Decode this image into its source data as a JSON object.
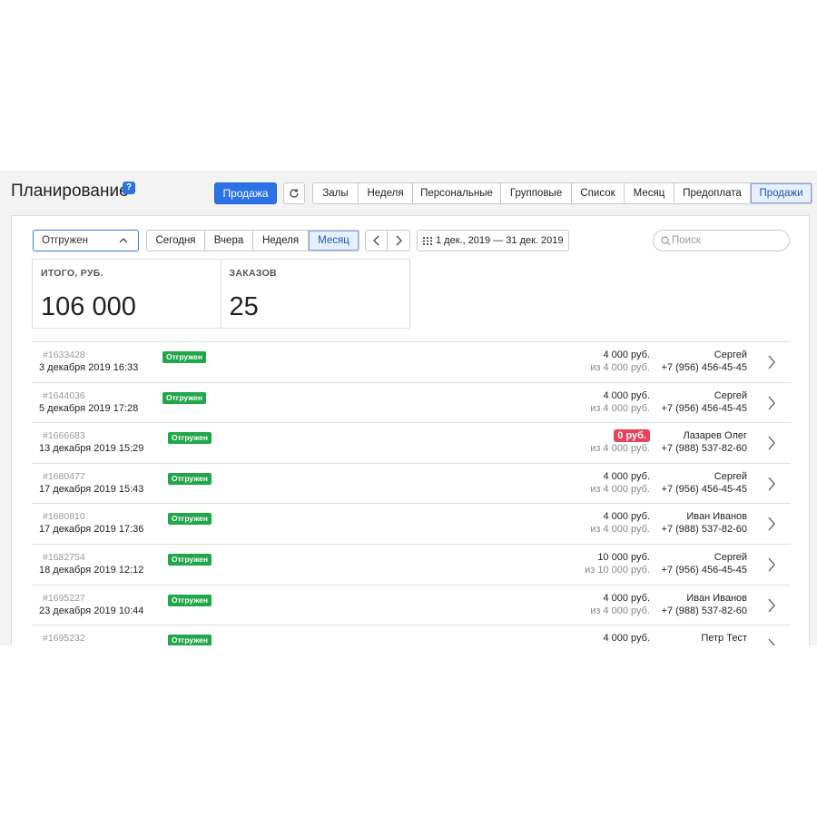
{
  "header": {
    "title": "Планирование",
    "help_icon": "?",
    "primary_button": "Продажа",
    "refresh_icon": "refresh-icon",
    "view_tabs": [
      {
        "label": "Залы",
        "active": false
      },
      {
        "label": "Неделя",
        "active": false
      },
      {
        "label": "Персональные",
        "active": false
      },
      {
        "label": "Групповые",
        "active": false
      },
      {
        "label": "Список",
        "active": false
      },
      {
        "label": "Месяц",
        "active": false
      },
      {
        "label": "Предоплата",
        "active": false
      },
      {
        "label": "Продажи",
        "active": true
      }
    ]
  },
  "filters": {
    "status_value": "Отгружен",
    "range_tabs": [
      {
        "label": "Сегодня",
        "active": false
      },
      {
        "label": "Вчера",
        "active": false
      },
      {
        "label": "Неделя",
        "active": false
      },
      {
        "label": "Месяц",
        "active": true
      }
    ],
    "date_range": "1 дек., 2019 — 31 дек. 2019",
    "search_placeholder": "Поиск"
  },
  "stats": {
    "total_label": "ИТОГО, РУБ.",
    "total_value": "106 000",
    "orders_label": "ЗАКАЗОВ",
    "orders_value": "25"
  },
  "orders": [
    {
      "id": "#1633428",
      "date": "3 декабря 2019 16:33",
      "status": "Отгружен",
      "amount": "4 000 руб.",
      "amount_of": "из 4 000 руб.",
      "client": "Сергей",
      "phone": "+7 (956) 456-45-45",
      "unpaid": false
    },
    {
      "id": "#1644036",
      "date": "5 декабря 2019 17:28",
      "status": "Отгружен",
      "amount": "4 000 руб.",
      "amount_of": "из 4 000 руб.",
      "client": "Сергей",
      "phone": "+7 (956) 456-45-45",
      "unpaid": false
    },
    {
      "id": "#1666683",
      "date": "13 декабря 2019 15:29",
      "status": "Отгружен",
      "amount": "0 руб.",
      "amount_of": "из 4 000 руб.",
      "client": "Лазарев Олег",
      "phone": "+7 (988) 537-82-60",
      "unpaid": true
    },
    {
      "id": "#1680477",
      "date": "17 декабря 2019 15:43",
      "status": "Отгружен",
      "amount": "4 000 руб.",
      "amount_of": "из 4 000 руб.",
      "client": "Сергей",
      "phone": "+7 (956) 456-45-45",
      "unpaid": false
    },
    {
      "id": "#1680810",
      "date": "17 декабря 2019 17:36",
      "status": "Отгружен",
      "amount": "4 000 руб.",
      "amount_of": "из 4 000 руб.",
      "client": "Иван Иванов",
      "phone": "+7 (988) 537-82-60",
      "unpaid": false
    },
    {
      "id": "#1682754",
      "date": "18 декабря 2019 12:12",
      "status": "Отгружен",
      "amount": "10 000 руб.",
      "amount_of": "из 10 000 руб.",
      "client": "Сергей",
      "phone": "+7 (956) 456-45-45",
      "unpaid": false
    },
    {
      "id": "#1695227",
      "date": "23 декабря 2019 10:44",
      "status": "Отгружен",
      "amount": "4 000 руб.",
      "amount_of": "из 4 000 руб.",
      "client": "Иван Иванов",
      "phone": "+7 (988) 537-82-60",
      "unpaid": false
    },
    {
      "id": "#1695232",
      "date": "",
      "status": "Отгружен",
      "amount": "4 000 руб.",
      "amount_of": "",
      "client": "Петр Тест",
      "phone": "",
      "unpaid": false
    }
  ],
  "colors": {
    "accent": "#2a72e6",
    "shipped_badge": "#22a64a",
    "unpaid_amount": "#e8415a"
  }
}
